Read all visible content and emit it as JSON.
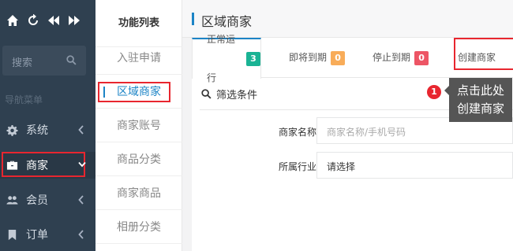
{
  "sidebar": {
    "search_placeholder": "搜索",
    "nav_header": "导航菜单",
    "items": [
      {
        "label": "系统"
      },
      {
        "label": "商家"
      },
      {
        "label": "会员"
      },
      {
        "label": "订单"
      }
    ]
  },
  "submenu": {
    "title": "功能列表",
    "items": [
      {
        "label": "入驻申请"
      },
      {
        "label": "区域商家"
      },
      {
        "label": "商家账号"
      },
      {
        "label": "商品分类"
      },
      {
        "label": "商家商品"
      },
      {
        "label": "相册分类"
      }
    ]
  },
  "main": {
    "title": "区域商家",
    "tabs": [
      {
        "label": "正常运行",
        "count": "3",
        "color": "#1ab394"
      },
      {
        "label": "即将到期",
        "count": "0",
        "color": "#f8ac59"
      },
      {
        "label": "停止到期",
        "count": "0",
        "color": "#ed5565"
      },
      {
        "label": "创建商家"
      }
    ],
    "filter_label": "筛选条件",
    "fields": [
      {
        "label": "商家名称",
        "placeholder": "商家名称/手机号码"
      },
      {
        "label": "所属行业",
        "value": "请选择"
      }
    ]
  },
  "callout": {
    "number": "1",
    "line1": "点击此处",
    "line2": "创建商家"
  }
}
